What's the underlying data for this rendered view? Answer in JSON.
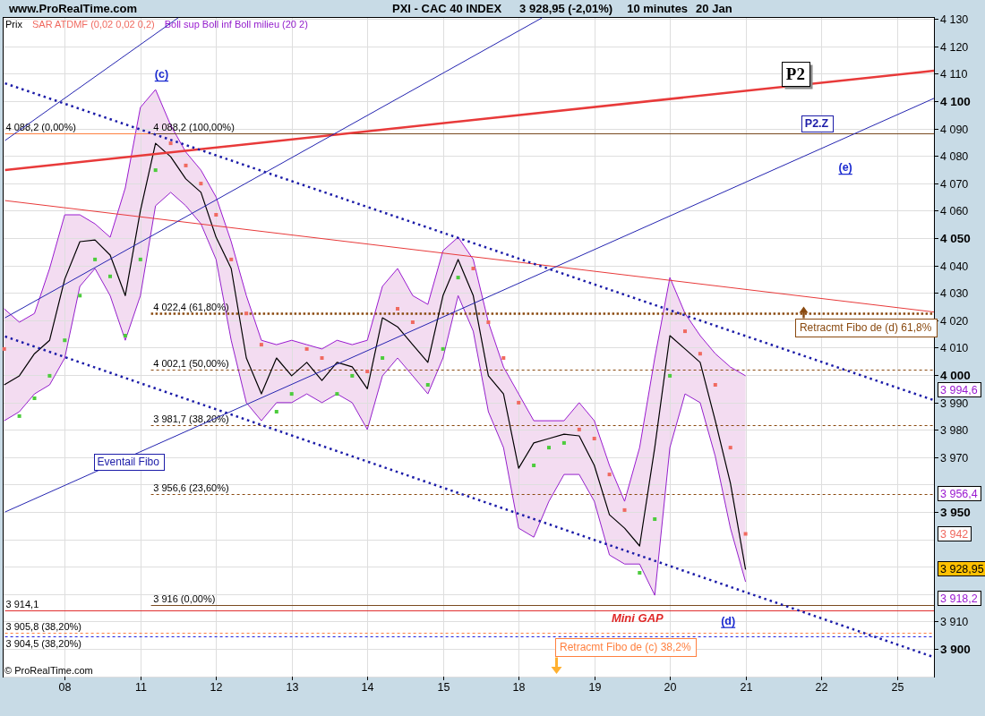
{
  "header": {
    "site": "www.ProRealTime.com",
    "title": "PXI - CAC 40 INDEX",
    "quote": "3 928,95 (-2,01%)",
    "interval": "10 minutes",
    "date": "20 Jan"
  },
  "chart": {
    "chart_data": {
      "type": "line",
      "grid": true,
      "categories": [
        null,
        null,
        null,
        null,
        "08",
        null,
        null,
        null,
        null,
        "11",
        null,
        null,
        null,
        null,
        "12",
        null,
        null,
        null,
        null,
        "13",
        null,
        null,
        null,
        null,
        "14",
        null,
        null,
        null,
        null,
        "15",
        null,
        null,
        null,
        null,
        "18",
        null,
        null,
        null,
        null,
        "19",
        null,
        null,
        null,
        null,
        "20",
        null,
        null,
        null,
        null,
        "21",
        null,
        null,
        null,
        null,
        "22",
        null,
        null,
        null,
        null,
        "25",
        null,
        null
      ],
      "ylim": [
        3889.9,
        4130.7
      ],
      "yticks": [
        {
          "value": 4130,
          "label": "4 130"
        },
        {
          "value": 4120,
          "label": "4 120"
        },
        {
          "value": 4110,
          "label": "4 110"
        },
        {
          "value": 4100,
          "label": "4 100"
        },
        {
          "value": 4090,
          "label": "4 090"
        },
        {
          "value": 4080,
          "label": "4 080"
        },
        {
          "value": 4070,
          "label": "4 070"
        },
        {
          "value": 4060,
          "label": "4 060"
        },
        {
          "value": 4050,
          "label": "4 050"
        },
        {
          "value": 4040,
          "label": "4 040"
        },
        {
          "value": 4030,
          "label": "4 030"
        },
        {
          "value": 4020,
          "label": "4 020"
        },
        {
          "value": 4010,
          "label": "4 010"
        },
        {
          "value": 4000,
          "label": "4 000"
        },
        {
          "value": 3990,
          "label": "3 990"
        },
        {
          "value": 3980,
          "label": "3 980"
        },
        {
          "value": 3970,
          "label": "3 970"
        },
        {
          "value": 3950,
          "label": "3 950"
        },
        {
          "value": 3910,
          "label": "3 910"
        },
        {
          "value": 3900,
          "label": "3 900"
        }
      ],
      "series": [
        {
          "name": "Prix",
          "color": "#000000",
          "values": [
            3996.4,
            3999.7,
            4007.8,
            4012.7,
            4035,
            4048.7,
            4049.3,
            4043.8,
            4029,
            4060,
            4084.6,
            4079.7,
            4071.6,
            4066.7,
            4050.3,
            4038.9,
            4006.2,
            3993.1,
            4006.2,
            3999.7,
            4004.6,
            3998,
            4004.6,
            4003,
            3995,
            4020.9,
            4017.6,
            4011.1,
            4004.6,
            4029,
            4042.2,
            4029,
            3999.7,
            3993.1,
            3966,
            3975.2,
            3976.8,
            3978.4,
            3977.8,
            3967,
            3949,
            3944.1,
            3937.6,
            3973.5,
            4014.4,
            4009.5,
            4004.6,
            3983.3,
            3960.5,
            3929,
            null,
            null,
            null,
            null,
            null,
            null,
            null,
            null,
            null,
            null,
            null,
            null
          ]
        },
        {
          "name": "SAR ATDMF (0,02 0,02 0,2)",
          "type": "scatter",
          "color": "#f06a60",
          "values": [
            4009.5,
            null,
            null,
            null,
            null,
            null,
            null,
            null,
            null,
            null,
            null,
            4084.6,
            4076.5,
            4069.9,
            4058.5,
            4042.2,
            4022.5,
            4011.1,
            null,
            null,
            4009.5,
            4006.2,
            null,
            null,
            4001.3,
            null,
            4024.2,
            4019.3,
            null,
            null,
            null,
            4038.9,
            4019.3,
            4006.2,
            3989.9,
            null,
            null,
            null,
            3980.1,
            3976.8,
            3963.7,
            3950.7,
            null,
            null,
            null,
            4016,
            4007.8,
            3996.4,
            3973.5,
            3942,
            null,
            null,
            null,
            null,
            null,
            null,
            null,
            null,
            null,
            null,
            null,
            null
          ]
        },
        {
          "type": "scatter",
          "color": "#4ccc3c",
          "values": [
            null,
            3985,
            3991.5,
            3999.7,
            4012.7,
            4029,
            4042.2,
            4036,
            4014.4,
            4042.2,
            4074.8,
            null,
            null,
            null,
            null,
            null,
            null,
            null,
            3986.6,
            3993.1,
            null,
            null,
            3993.1,
            3999.7,
            null,
            4006.2,
            null,
            null,
            3996.4,
            4009.5,
            4035.6,
            null,
            null,
            null,
            null,
            3967,
            3973.5,
            3975.2,
            null,
            null,
            null,
            null,
            3927.8,
            3947.4,
            3999.7,
            null,
            null,
            null,
            null,
            null,
            null,
            null,
            null,
            null,
            null,
            null,
            null,
            null,
            null,
            null,
            null,
            null
          ]
        },
        {
          "name": "Boll sup",
          "color": "#9a1ad0",
          "values": [
            4024.2,
            4019.3,
            4022.5,
            4038.9,
            4058.5,
            4058.5,
            4055.2,
            4050.3,
            4068.3,
            4097.7,
            4104.2,
            4091.2,
            4081.4,
            4074.8,
            4065,
            4048.7,
            4029,
            4012.7,
            4011.1,
            4012.7,
            4011.1,
            4009.5,
            4012.7,
            4011.1,
            4012.7,
            4032.4,
            4038.9,
            4029,
            4025.8,
            4045.4,
            4050.3,
            4042.2,
            4019.3,
            4002.9,
            3993.1,
            3983.3,
            3983.3,
            3983.3,
            3989.9,
            3983.3,
            3967,
            3953.9,
            3973.5,
            4006.2,
            4035.6,
            4022.5,
            4014.4,
            4007.8,
            4002.9,
            3999.7,
            null,
            null,
            null,
            null,
            null,
            null,
            null,
            null,
            null,
            null,
            null,
            null
          ]
        },
        {
          "name": "Boll inf",
          "color": "#9420cc",
          "values": [
            3983.3,
            3986.6,
            3993.1,
            3996.4,
            4006.2,
            4032.4,
            4038.9,
            4029,
            4012.7,
            4029,
            4061.8,
            4066.7,
            4061.8,
            4055.2,
            4042.2,
            4012.7,
            3989.9,
            3983.3,
            3989.9,
            3989.9,
            3993.1,
            3989.9,
            3993.1,
            3989.9,
            3980.1,
            3999.7,
            4006.2,
            3999.7,
            3993.1,
            4006.2,
            4029,
            4016,
            3986.6,
            3973.5,
            3944.1,
            3940.8,
            3953.9,
            3963.7,
            3963.7,
            3953.9,
            3934.3,
            3931,
            3931,
            3919.6,
            3973.5,
            3993.1,
            3989.9,
            3970.3,
            3944.1,
            3924.5,
            null,
            null,
            null,
            null,
            null,
            null,
            null,
            null,
            null,
            null,
            null,
            null
          ]
        }
      ],
      "ref_lines": [
        {
          "axis": "y",
          "value": 4088.2,
          "label": "4 088,2 (0,00%)",
          "color": "#ff8040"
        },
        {
          "axis": "y",
          "value": 4088.2,
          "label": "4 088,2 (100,00%)",
          "color": "#7a4a20"
        },
        {
          "axis": "y",
          "value": 4022.4,
          "label": "4 022,4 (61,80%)",
          "color": "#8a4a10"
        },
        {
          "axis": "y",
          "value": 4002.1,
          "label": "4 002,1 (50,00%)",
          "color": "#8a4a10"
        },
        {
          "axis": "y",
          "value": 3981.7,
          "label": "3 981,7 (38,20%)",
          "color": "#8a4a10"
        },
        {
          "axis": "y",
          "value": 3956.6,
          "label": "3 956,6 (23,60%)",
          "color": "#8a4a10"
        },
        {
          "axis": "y",
          "value": 3914.1,
          "label": "3 914,1",
          "color": "#e03030"
        },
        {
          "axis": "y",
          "value": 3916,
          "label": "3 916 (0,00%)",
          "color": "#7a4a20"
        },
        {
          "axis": "y",
          "value": 3905.8,
          "label": "3 905,8 (38,20%)",
          "color": "#ff8040"
        },
        {
          "axis": "y",
          "value": 3904.5,
          "label": "3 904,5 (38,20%)",
          "color": "#2020e0"
        }
      ]
    },
    "legend_note": "Boll milieu (20 2)",
    "notes": [
      {
        "kind": "wave",
        "text": "(c)",
        "color": "#1a2ad0"
      },
      {
        "kind": "title",
        "text": "P2",
        "color": "#000000"
      },
      {
        "kind": "tag",
        "text": "P2.Z",
        "color": "#1c1ca8"
      },
      {
        "kind": "wave",
        "text": "(e)",
        "color": "#1a2ad0"
      },
      {
        "kind": "arrowup",
        "text": "Retracmt Fibo de (d) 61,8%",
        "color": "#8a4a10"
      },
      {
        "kind": "box",
        "text": "Eventail Fibo",
        "color": "#1c1ca8"
      },
      {
        "kind": "caption",
        "text": "Mini GAP",
        "color": "#e02828"
      },
      {
        "kind": "wave",
        "text": "(d)",
        "color": "#1a2ad0"
      },
      {
        "kind": "arrowdown",
        "text": "Retracmt Fibo de (c) 38,2%",
        "color": "#ff8040"
      }
    ],
    "price_tags": [
      {
        "kind": "value",
        "text": "3 994,6",
        "color": "#9a1ad0"
      },
      {
        "kind": "value",
        "text": "3 956,4",
        "color": "#9a1ad0"
      },
      {
        "kind": "value",
        "text": "3 942",
        "color": "#f06a60"
      },
      {
        "kind": "last",
        "text": "3 928,95"
      },
      {
        "kind": "value",
        "text": "3 918,2",
        "color": "#9a1ad0"
      }
    ],
    "copyright": "© ProRealTime.com"
  }
}
